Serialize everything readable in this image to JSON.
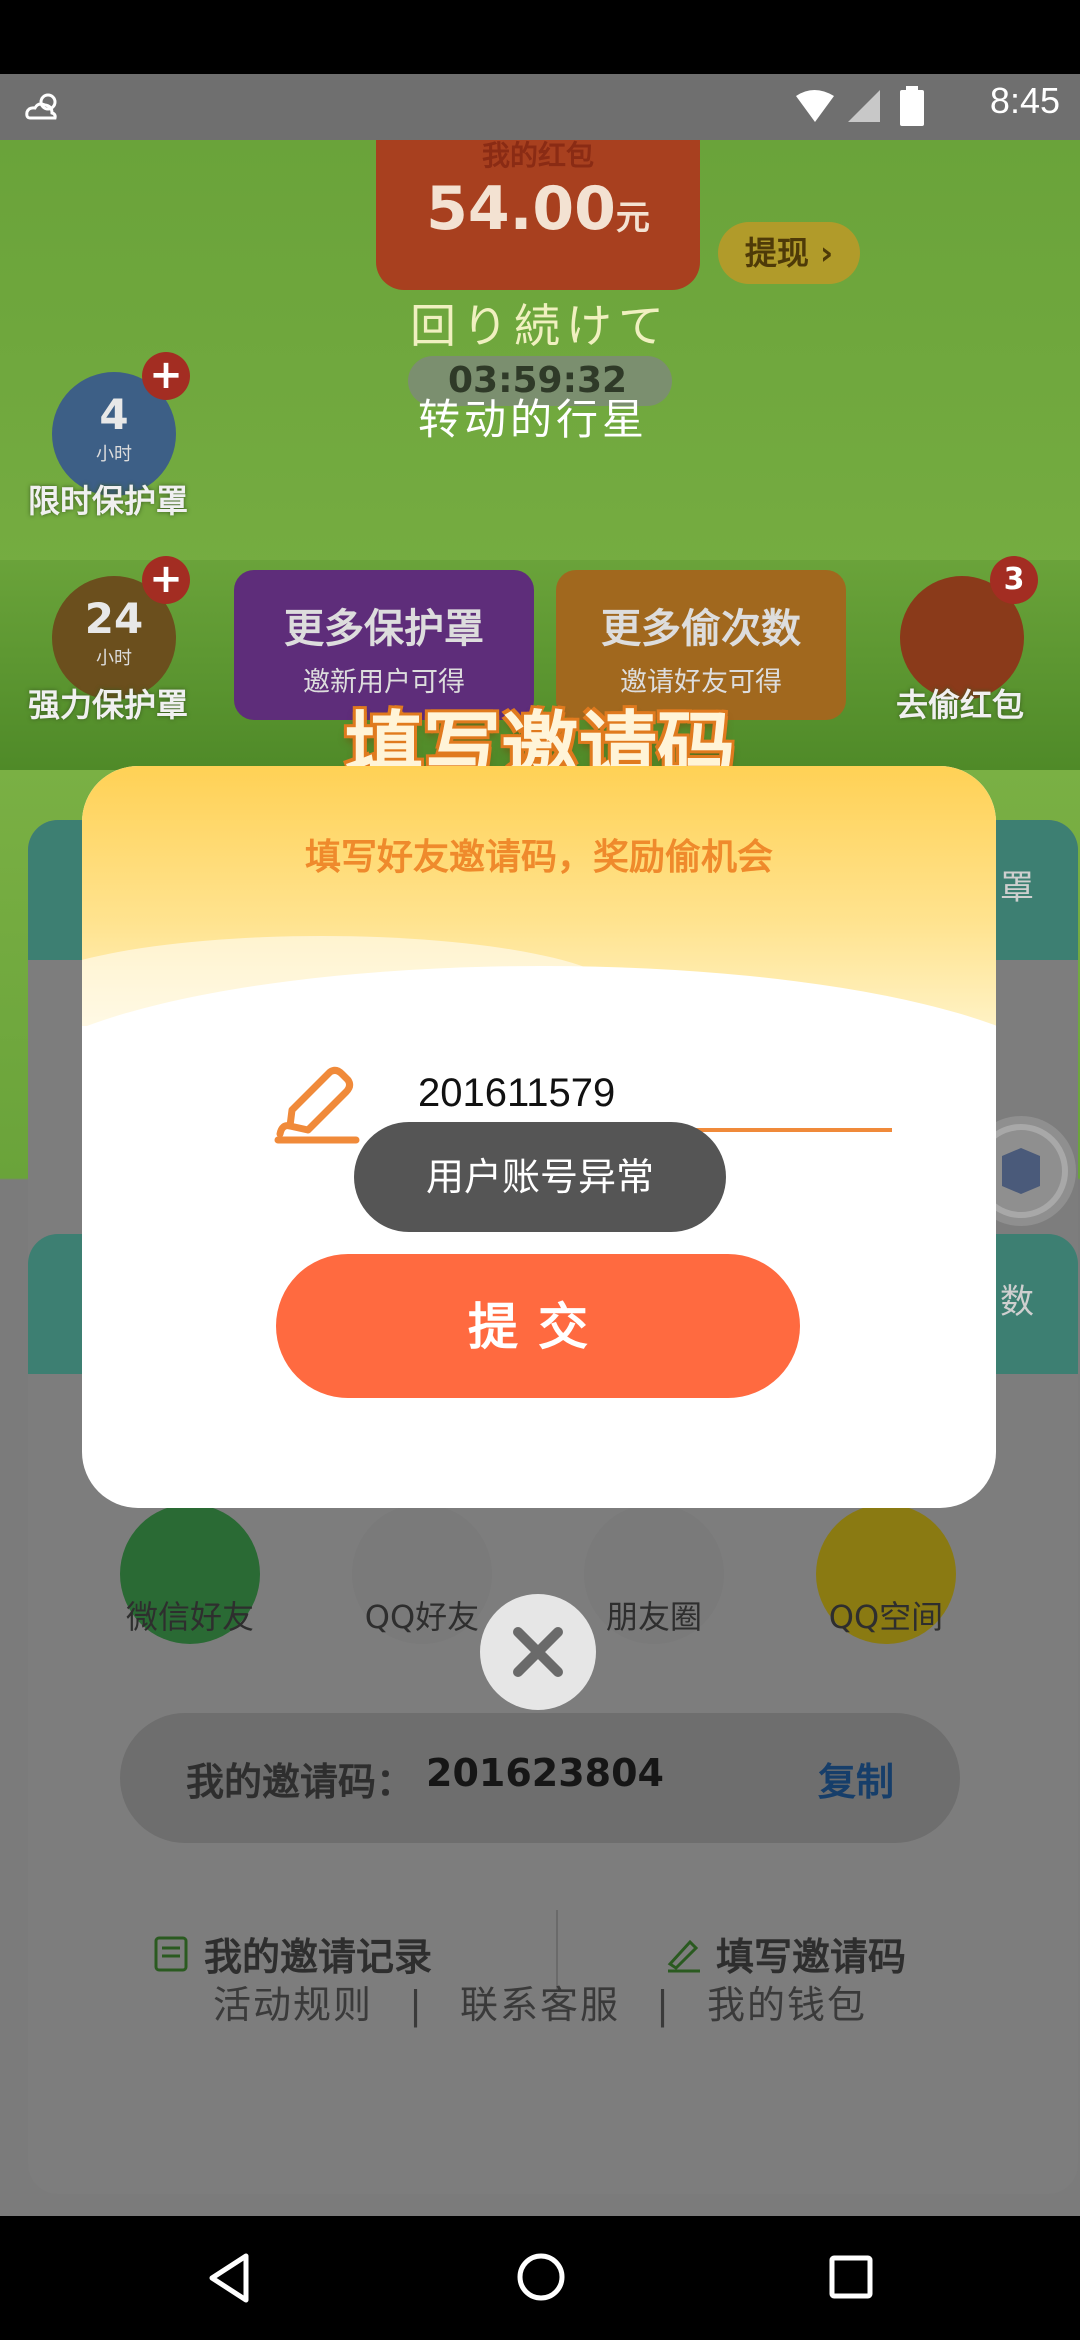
{
  "status_bar": {
    "time": "8:45",
    "weather_icon": "cloud-sun-icon"
  },
  "background": {
    "red_packet": {
      "title": "我的红包",
      "amount": "54.00",
      "unit": "元"
    },
    "withdraw_label": "提现",
    "lyric_line1": "回り続けて",
    "timer": "03:59:32",
    "lyric_line2": "转动的行星",
    "shields": [
      {
        "number": "4",
        "unit": "小时",
        "label": "限时保护罩"
      },
      {
        "number": "24",
        "unit": "小时",
        "label": "强力保护罩"
      }
    ],
    "promos": [
      {
        "title": "更多保护罩",
        "sub": "邀新用户可得"
      },
      {
        "title": "更多偷次数",
        "sub": "邀请好友可得"
      }
    ],
    "steal_badge": "3",
    "steal_label": "去偷红包",
    "side_text_1": "罩",
    "side_text_2": "数",
    "share_targets": [
      "微信好友",
      "QQ好友",
      "朋友圈",
      "QQ空间"
    ],
    "my_invite_label": "我的邀请码：",
    "my_invite_code": "201623804",
    "copy_label": "复制",
    "record_label": "我的邀请记录",
    "fill_code_label": "填写邀请码",
    "footer": {
      "rules": "活动规则",
      "sep": "|",
      "service": "联系客服",
      "wallet": "我的钱包"
    }
  },
  "modal": {
    "title": "填写邀请码",
    "subtitle": "填写好友邀请码，奖励偷机会",
    "input_value": "201611579",
    "submit_label": "提交",
    "toast": "用户账号异常"
  },
  "colors": {
    "accent_orange": "#ff6a40",
    "title_orange": "#e07a1e",
    "subtitle_orange": "#ef8a2c"
  }
}
